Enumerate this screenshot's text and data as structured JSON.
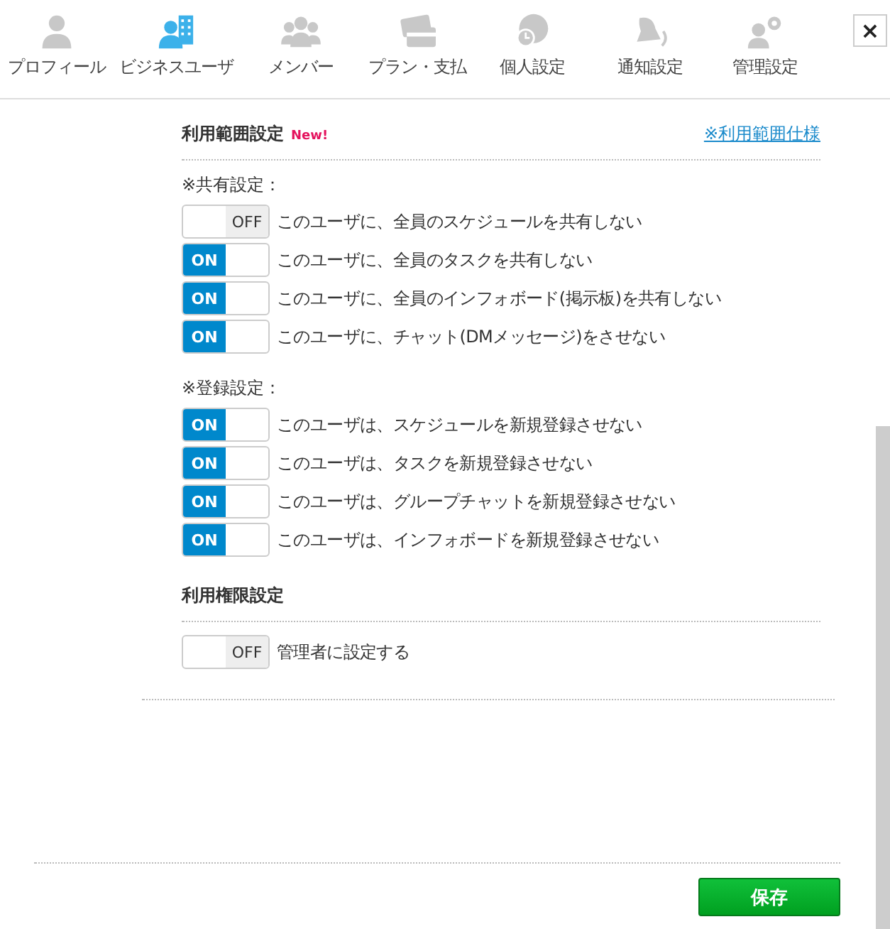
{
  "tabs": [
    {
      "label": "プロフィール",
      "selected": false,
      "kind": "person"
    },
    {
      "label": "ビジネスユーザ",
      "selected": true,
      "kind": "business"
    },
    {
      "label": "メンバー",
      "selected": false,
      "kind": "group"
    },
    {
      "label": "プラン・支払",
      "selected": false,
      "kind": "card"
    },
    {
      "label": "個人設定",
      "selected": false,
      "kind": "globe"
    },
    {
      "label": "通知設定",
      "selected": false,
      "kind": "bell"
    },
    {
      "label": "管理設定",
      "selected": false,
      "kind": "admin"
    }
  ],
  "close_button": "×",
  "usage_section": {
    "title": "利用範囲設定",
    "badge": "New!",
    "link": "※利用範囲仕様",
    "groups": [
      {
        "heading": "※共有設定：",
        "items": [
          {
            "toggle_text": "OFF",
            "on": false,
            "label": "このユーザに、全員のスケジュールを共有しない"
          },
          {
            "toggle_text": "ON",
            "on": true,
            "label": "このユーザに、全員のタスクを共有しない"
          },
          {
            "toggle_text": "ON",
            "on": true,
            "label": "このユーザに、全員のインフォボード(掲示板)を共有しない"
          },
          {
            "toggle_text": "ON",
            "on": true,
            "label": "このユーザに、チャット(DMメッセージ)をさせない"
          }
        ]
      },
      {
        "heading": "※登録設定：",
        "items": [
          {
            "toggle_text": "ON",
            "on": true,
            "label": "このユーザは、スケジュールを新規登録させない"
          },
          {
            "toggle_text": "ON",
            "on": true,
            "label": "このユーザは、タスクを新規登録させない"
          },
          {
            "toggle_text": "ON",
            "on": true,
            "label": "このユーザは、グループチャットを新規登録させない"
          },
          {
            "toggle_text": "ON",
            "on": true,
            "label": "このユーザは、インフォボードを新規登録させない"
          }
        ]
      }
    ]
  },
  "permission_section": {
    "title": "利用権限設定",
    "items": [
      {
        "toggle_text": "OFF",
        "on": false,
        "label": "管理者に設定する"
      }
    ]
  },
  "save_button": "保存"
}
